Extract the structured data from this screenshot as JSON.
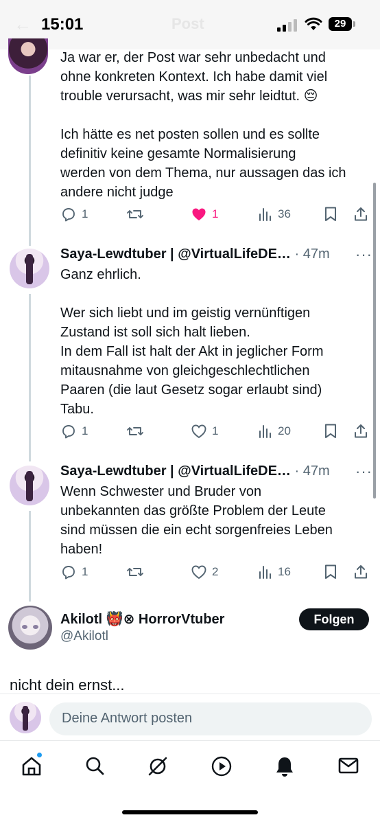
{
  "status": {
    "time": "15:01",
    "battery": "29"
  },
  "header": {
    "title": "Post"
  },
  "thread": [
    {
      "text": "Ja war er,  der Post war sehr unbedacht und\nohne konkreten Kontext. Ich habe damit viel\ntrouble verursacht, was mir sehr leidtut. 😔\n\nIch hätte es net posten sollen und es sollte\ndefinitiv keine gesamte Normalisierung\nwerden von dem Thema, nur aussagen das ich\nandere nicht judge",
      "replies": "1",
      "likes": "1",
      "liked": true,
      "views": "36"
    },
    {
      "author": "Saya-Lewdtuber | @VirtualLifeDE…",
      "time": "· 47m",
      "text": "Ganz ehrlich.\n\nWer sich liebt und im geistig vernünftigen\nZustand ist soll sich halt lieben.\nIn dem Fall ist halt der Akt in jeglicher Form\nmitausnahme von gleichgeschlechtlichen\nPaaren (die laut Gesetz sogar erlaubt sind)\nTabu.",
      "replies": "1",
      "likes": "1",
      "liked": false,
      "views": "20"
    },
    {
      "author": "Saya-Lewdtuber | @VirtualLifeDE…",
      "time": "· 47m",
      "text": "Wenn Schwester und Bruder von\nunbekannten das größte Problem der Leute\nsind müssen die ein echt sorgenfreies Leben\nhaben!",
      "replies": "1",
      "likes": "2",
      "liked": false,
      "views": "16"
    }
  ],
  "main_post": {
    "name": "Akilotl 👹⊗ HorrorVtuber",
    "handle": "@Akilotl",
    "follow_label": "Folgen",
    "text": "nicht dein ernst..."
  },
  "reply": {
    "placeholder": "Deine Antwort posten"
  },
  "colors": {
    "accent": "#1d9bf0",
    "like": "#f91880",
    "text": "#0f1419",
    "muted": "#536471"
  },
  "nav": [
    "home-icon",
    "search-icon",
    "grok-icon",
    "video-icon",
    "notifications-icon",
    "messages-icon"
  ]
}
